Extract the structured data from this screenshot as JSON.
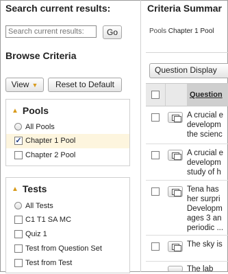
{
  "search": {
    "heading": "Search current results:",
    "placeholder": "Search current results:",
    "go_label": "Go"
  },
  "browse": {
    "heading": "Browse Criteria",
    "view_label": "View",
    "reset_label": "Reset to Default"
  },
  "pools": {
    "title": "Pools",
    "items": [
      {
        "label": "All Pools",
        "type": "radio",
        "checked": false
      },
      {
        "label": "Chapter 1 Pool",
        "type": "checkbox",
        "checked": true
      },
      {
        "label": "Chapter 2 Pool",
        "type": "checkbox",
        "checked": false
      }
    ]
  },
  "tests": {
    "title": "Tests",
    "items": [
      {
        "label": "All Tests",
        "type": "radio",
        "checked": false
      },
      {
        "label": "C1 T1 SA MC",
        "type": "checkbox",
        "checked": false
      },
      {
        "label": "Quiz 1",
        "type": "checkbox",
        "checked": false
      },
      {
        "label": "Test from Question Set",
        "type": "checkbox",
        "checked": false
      },
      {
        "label": "Test from Test",
        "type": "checkbox",
        "checked": false
      }
    ]
  },
  "summary": {
    "heading": "Criteria Summar",
    "pools_label": "Pools",
    "pools_value": "Chapter 1 Pool",
    "question_display_label": "Question Display",
    "question_col_header": "Question",
    "rows": [
      {
        "lines": [
          "A crucial e",
          "developm",
          "the scienc"
        ]
      },
      {
        "lines": [
          "A crucial e",
          "developm",
          "study of h"
        ]
      },
      {
        "lines": [
          "Tena has",
          "her surpri",
          "Developm",
          "ages 3 an",
          "periodic ..."
        ]
      },
      {
        "lines": [
          "The sky is"
        ]
      },
      {
        "lines": [
          "The lab"
        ]
      }
    ]
  },
  "colors": {
    "accent_orange": "#d89a1b",
    "selected_row_bg": "#fdf5de",
    "header_bg": "#e9e9e9"
  }
}
